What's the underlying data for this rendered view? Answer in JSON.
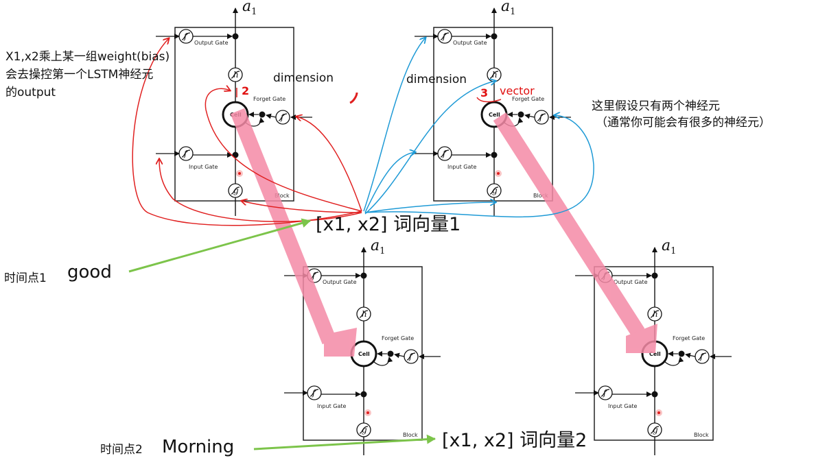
{
  "blocks": [
    {
      "output_label": "a",
      "output_sub": "1",
      "output_gate": "Output Gate",
      "forget_gate": "Forget Gate",
      "input_gate": "Input Gate",
      "cell": "Cell",
      "block": "Block"
    },
    {
      "output_label": "a",
      "output_sub": "1",
      "output_gate": "Output Gate",
      "forget_gate": "Forget Gate",
      "input_gate": "Input Gate",
      "cell": "Cell",
      "block": "Block"
    },
    {
      "output_label": "a",
      "output_sub": "1",
      "output_gate": "Output Gate",
      "forget_gate": "Forget Gate",
      "input_gate": "Input Gate",
      "cell": "Cell",
      "block": "Block"
    },
    {
      "output_label": "a",
      "output_sub": "1",
      "output_gate": "Output Gate",
      "forget_gate": "Forget Gate",
      "input_gate": "Input Gate",
      "cell": "Cell",
      "block": "Block"
    }
  ],
  "annotations": {
    "weight_note_line1": "X1,x2乘上某一组weight(bias)",
    "weight_note_line2": "会去操控第一个LSTM神经元",
    "weight_note_line3": "的output",
    "dimension_left": "dimension",
    "dimension_right": "dimension",
    "vector": "vector",
    "marker_2": "2",
    "marker_3": "3",
    "neuron_note_line1": "这里假设只有两个神经元",
    "neuron_note_line2": "（通常你可能会有很多的神经元）",
    "word_vector_1": "[x1, x2]  词向量1",
    "word_vector_2": "[x1, x2]  词向量2",
    "timestep_1": "时间点1",
    "word_1": "good",
    "timestep_2": "时间点2",
    "word_2": "Morning"
  },
  "colors": {
    "red_arrow": "#e02020",
    "blue_arrow": "#1e9ad6",
    "green_arrow": "#7cc44a",
    "pink_arrow": "#f48aa6"
  }
}
